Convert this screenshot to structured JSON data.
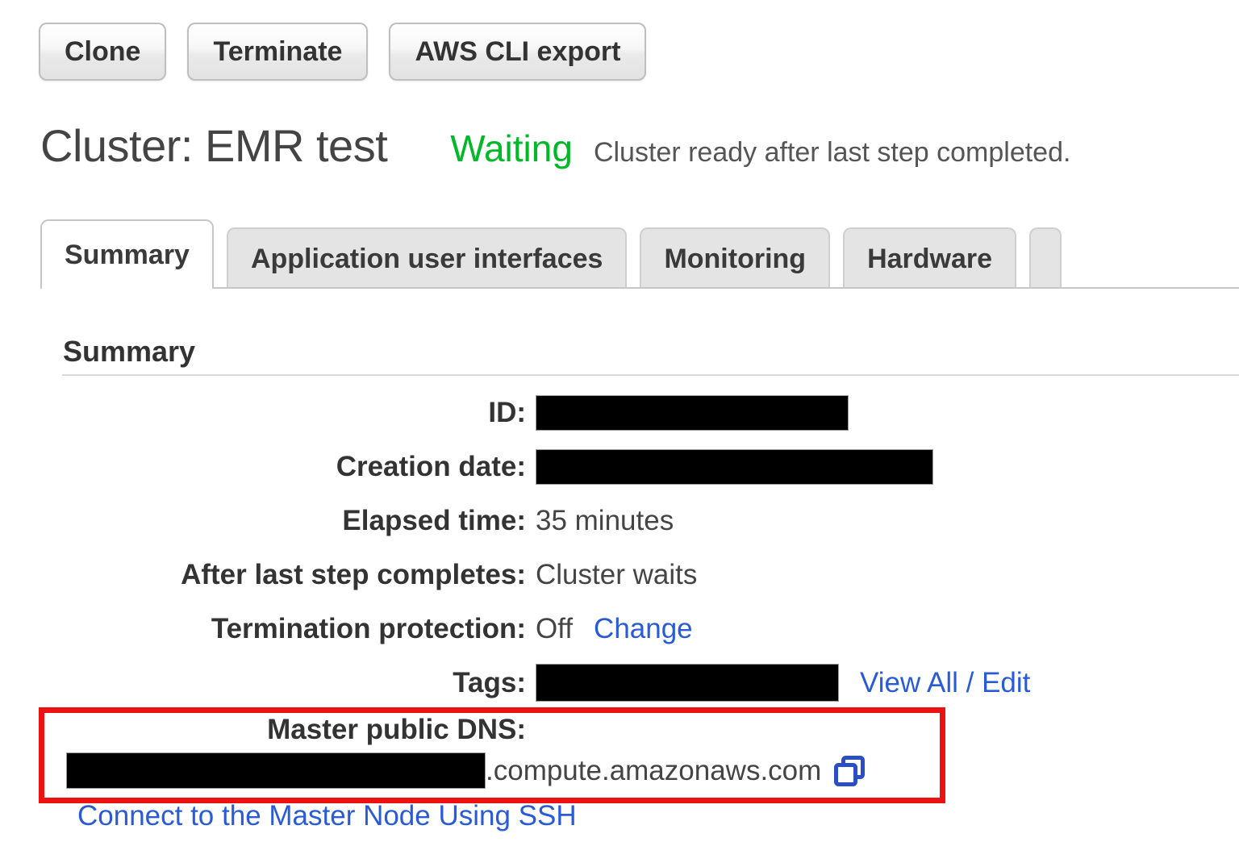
{
  "toolbar": {
    "buttons": [
      {
        "label": "Clone",
        "name": "clone-button"
      },
      {
        "label": "Terminate",
        "name": "terminate-button"
      },
      {
        "label": "AWS CLI export",
        "name": "aws-cli-export-button"
      }
    ]
  },
  "header": {
    "title": "Cluster: EMR test",
    "status_state": "Waiting",
    "status_message": "Cluster ready after last step completed.",
    "status_color": "#00b828"
  },
  "tabs": [
    {
      "label": "Summary",
      "active": true
    },
    {
      "label": "Application user interfaces",
      "active": false
    },
    {
      "label": "Monitoring",
      "active": false
    },
    {
      "label": "Hardware",
      "active": false
    },
    {
      "label": "",
      "active": false
    }
  ],
  "summary": {
    "heading": "Summary",
    "rows": [
      {
        "label": "ID:",
        "value": "",
        "redacted": true,
        "redact_width": 388
      },
      {
        "label": "Creation date:",
        "value": "",
        "redacted": true,
        "redact_width": 493
      },
      {
        "label": "Elapsed time:",
        "value": "35 minutes",
        "redacted": false
      },
      {
        "label": "After last step completes:",
        "value": "Cluster waits",
        "redacted": false
      },
      {
        "label": "Termination protection:",
        "value": "Off",
        "redacted": false,
        "link": "Change"
      },
      {
        "label": "Tags:",
        "value": "",
        "redacted": true,
        "redact_width": 376,
        "link": "View All / Edit"
      }
    ]
  },
  "master_dns": {
    "label": "Master public DNS:",
    "redacted_prefix": true,
    "redact_width": 520,
    "suffix": ".compute.amazonaws.com",
    "copy_icon": "copy-icon",
    "highlight_color": "#ee1111"
  },
  "ssh_link": "Connect to the Master Node Using SSH"
}
